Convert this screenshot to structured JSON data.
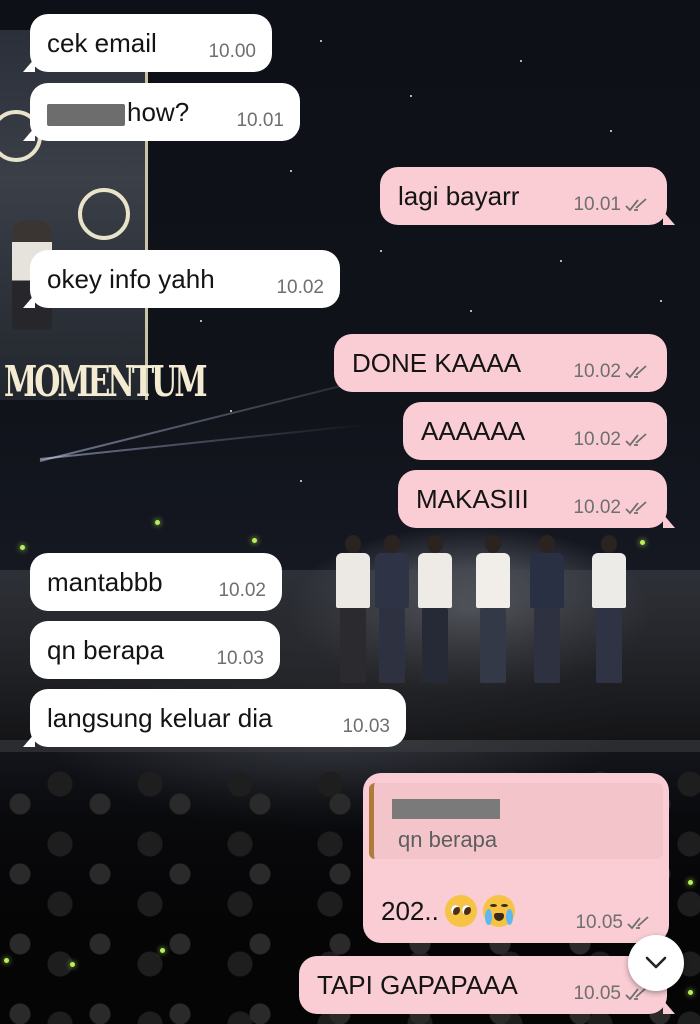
{
  "messages": [
    {
      "direction": "in",
      "text": "cek email",
      "time": "10.00"
    },
    {
      "direction": "in",
      "text": "how?",
      "time": "10.01",
      "redacted_prefix": true
    },
    {
      "direction": "out",
      "text": "lagi bayarr",
      "time": "10.01",
      "read": true
    },
    {
      "direction": "in",
      "text": "okey info yahh",
      "time": "10.02"
    },
    {
      "direction": "out",
      "text": "DONE KAAAA",
      "time": "10.02",
      "read": true
    },
    {
      "direction": "out",
      "text": "AAAAAA",
      "time": "10.02",
      "read": true
    },
    {
      "direction": "out",
      "text": "MAKASIII",
      "time": "10.02",
      "read": true
    },
    {
      "direction": "in",
      "text": "mantabbb",
      "time": "10.02"
    },
    {
      "direction": "in",
      "text": "qn berapa",
      "time": "10.03"
    },
    {
      "direction": "in",
      "text": "langsung keluar dia",
      "time": "10.03"
    }
  ],
  "reply": {
    "quoted_text": "qn berapa",
    "quoted_sender_redacted": true,
    "text": "202..",
    "emojis": [
      "pleading-face-emoji",
      "loudly-crying-face-emoji"
    ],
    "time": "10.05",
    "read": true
  },
  "last_message": {
    "direction": "out",
    "text": "TAPI GAPAPAAA",
    "time": "10.05",
    "read": true
  },
  "background": {
    "screen_logo_text": "MOMENTUM"
  },
  "colors": {
    "incoming_bubble": "#ffffff",
    "outgoing_bubble": "#f9cdd3",
    "quote_bar": "#b07a3c",
    "timestamp": "#6f6f6f"
  },
  "icons": {
    "read_receipt": "double-check-icon",
    "scroll_down": "chevron-down-icon"
  }
}
